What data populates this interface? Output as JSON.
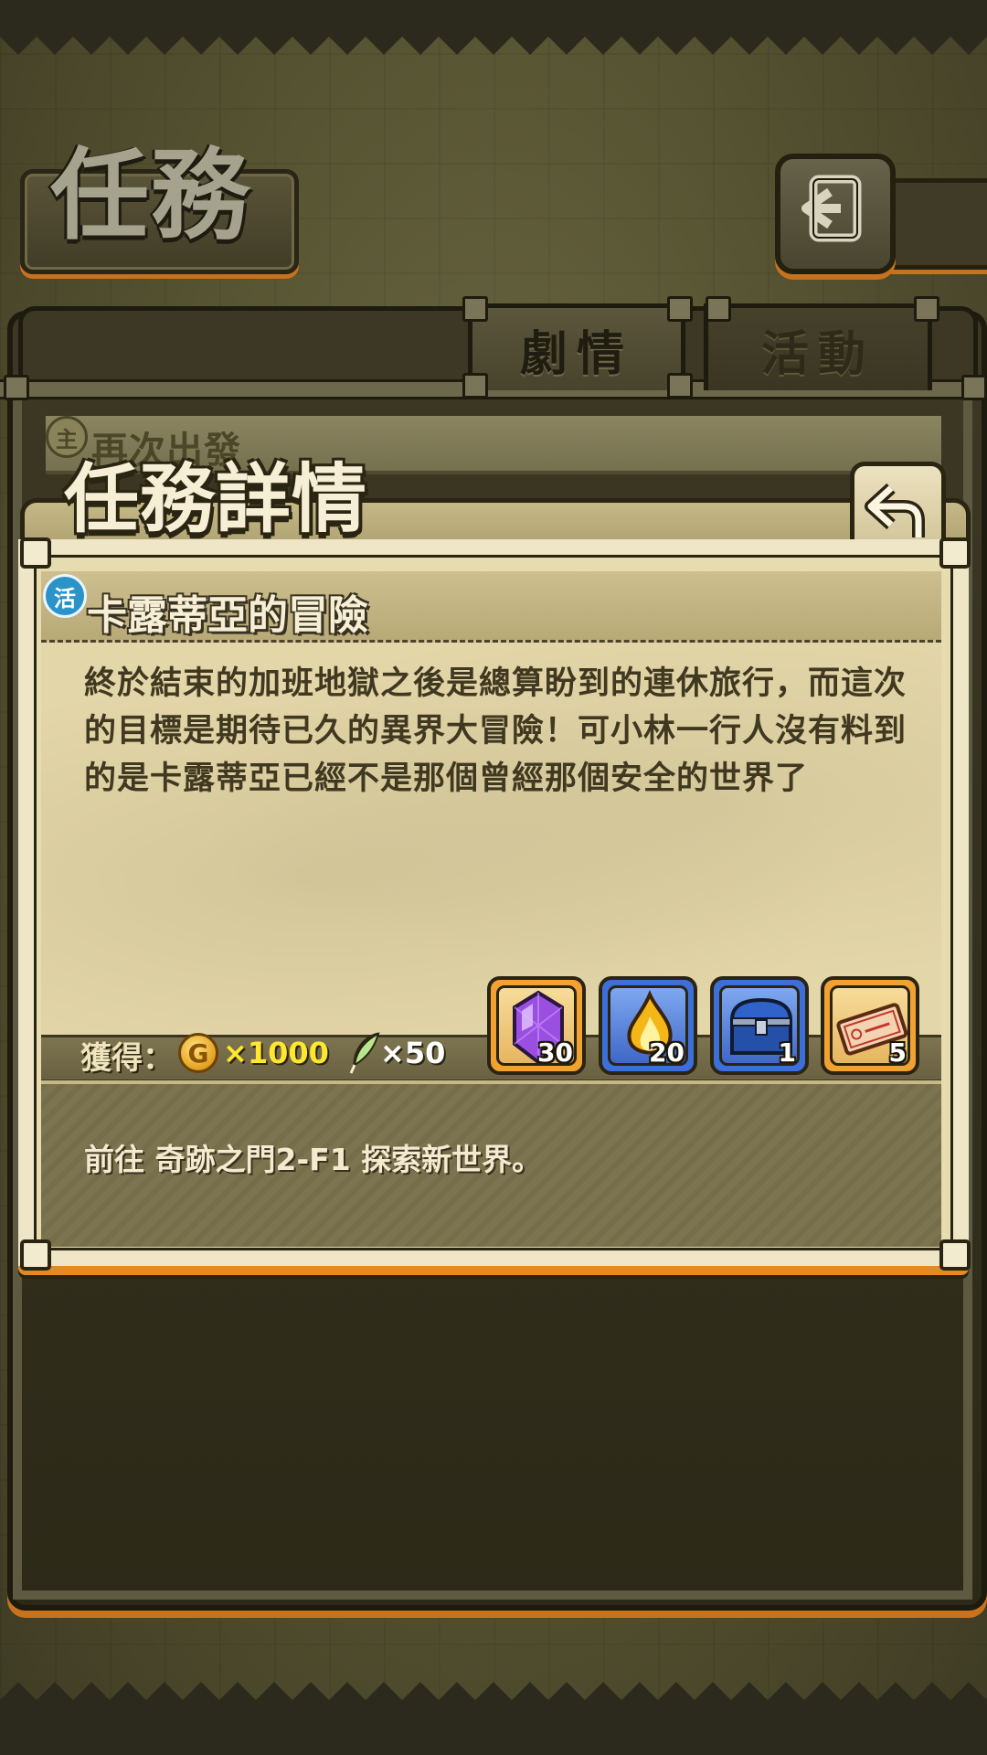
{
  "screen": {
    "title": "任務",
    "tabs": [
      {
        "label": "劇情",
        "active": true
      },
      {
        "label": "活動",
        "active": false
      }
    ],
    "quest_list": {
      "badge": "主",
      "first_item": "再次出發"
    }
  },
  "detail": {
    "title": "任務詳情",
    "quest_type_badge": "活",
    "quest_name": "卡露蒂亞的冒險",
    "description": "終於結束的加班地獄之後是總算盼到的連休旅行，而這次的目標是期待已久的異界大冒險！可小林一行人沒有料到的是卡露蒂亞已經不是那個曾經那個安全的世界了",
    "rewards": {
      "label": "獲得：",
      "gold_symbol": "G",
      "gold": "×1000",
      "feather": "×50",
      "items": [
        {
          "icon": "purple-crystal-icon",
          "count": "30",
          "frame": "orange"
        },
        {
          "icon": "fire-drop-icon",
          "count": "20",
          "frame": "blue"
        },
        {
          "icon": "treasure-chest-icon",
          "count": "1",
          "frame": "blue"
        },
        {
          "icon": "ticket-icon",
          "count": "5",
          "frame": "orange"
        }
      ]
    },
    "objective": "前往 奇跡之門2-F1 探索新世界。"
  },
  "colors": {
    "accent_orange": "#e38b22",
    "parchment": "#e7dbb0",
    "gold_text": "#ffe72e"
  }
}
